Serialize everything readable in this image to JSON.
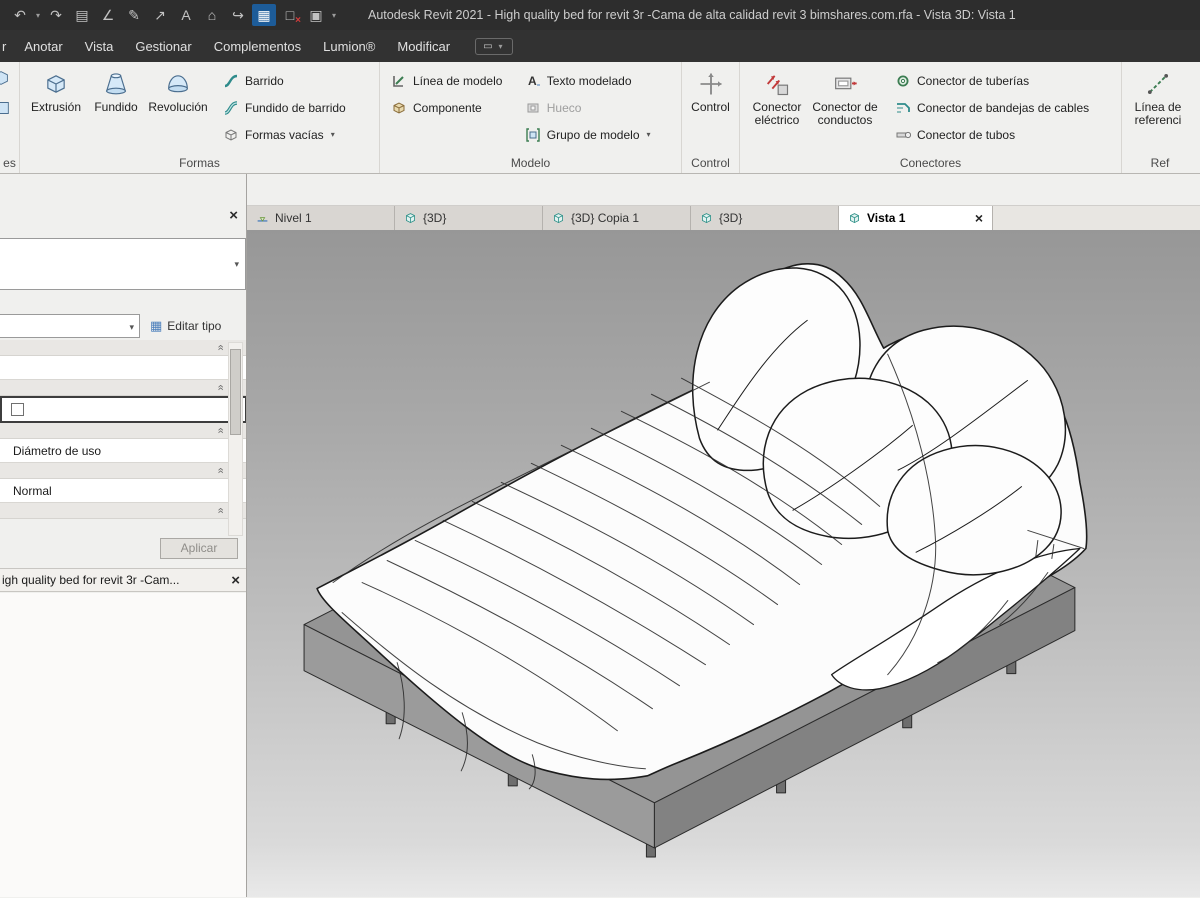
{
  "titlebar": {
    "title": "Autodesk Revit 2021 - High quality bed for revit  3r -Cama de alta calidad revit 3 bimshares.com.rfa - Vista 3D: Vista 1",
    "icons": [
      {
        "name": "undo-icon",
        "glyph": "↶"
      },
      {
        "name": "redo-icon",
        "glyph": "↷"
      },
      {
        "name": "print-icon",
        "glyph": "▤"
      },
      {
        "name": "scale-icon",
        "glyph": "∠"
      },
      {
        "name": "measure-icon",
        "glyph": "✎"
      },
      {
        "name": "dimension-icon",
        "glyph": "↗"
      },
      {
        "name": "text-icon",
        "glyph": "A"
      },
      {
        "name": "view-cube-icon",
        "glyph": "⌂"
      },
      {
        "name": "forward-icon",
        "glyph": "↪"
      },
      {
        "name": "schedule-icon",
        "glyph": "▦"
      },
      {
        "name": "close-hidden-windows-icon",
        "glyph": "□"
      },
      {
        "name": "switch-windows-icon",
        "glyph": "▣"
      }
    ]
  },
  "menubar": {
    "partial_tab": "r",
    "tabs": [
      "Anotar",
      "Vista",
      "Gestionar",
      "Complementos",
      "Lumion®",
      "Modificar"
    ]
  },
  "ribbon": {
    "cut_panel_label": "es",
    "formas": {
      "label": "Formas",
      "buttons": [
        {
          "label": "Extrusión"
        },
        {
          "label": "Fundido"
        },
        {
          "label": "Revolución"
        }
      ],
      "list": [
        {
          "label": "Barrido"
        },
        {
          "label": "Fundido de barrido"
        },
        {
          "label": "Formas vacías",
          "dropdown": true
        }
      ]
    },
    "modelo": {
      "label": "Modelo",
      "col1": [
        {
          "label": "Línea de modelo"
        },
        {
          "label": "Componente"
        }
      ],
      "col2": [
        {
          "label": "Texto modelado"
        },
        {
          "label": "Hueco",
          "disabled": true
        },
        {
          "label": "Grupo de modelo",
          "dropdown": true
        }
      ]
    },
    "control": {
      "label": "Control",
      "button": "Control"
    },
    "conectores": {
      "label": "Conectores",
      "big": [
        {
          "label": "Conector eléctrico"
        },
        {
          "label": "Conector de conductos"
        }
      ],
      "list": [
        {
          "label": "Conector de tuberías"
        },
        {
          "label": "Conector de bandejas de cables"
        },
        {
          "label": "Conector de tubos"
        }
      ]
    },
    "referencia": {
      "label": "Ref",
      "button": "Línea de referenci"
    }
  },
  "properties": {
    "edit_type_label": "Editar tipo",
    "rows": [
      {
        "label": "Diámetro de uso"
      },
      {
        "label": "Normal"
      }
    ],
    "apply_label": "Aplicar",
    "browser_caption": "igh quality bed for revit  3r -Cam..."
  },
  "view_tabs": [
    {
      "label": "Nivel 1",
      "icon": "level-icon",
      "active": false
    },
    {
      "label": "{3D}",
      "icon": "3d-view-icon",
      "active": false
    },
    {
      "label": "{3D} Copia 1",
      "icon": "3d-view-icon",
      "active": false
    },
    {
      "label": "{3D}",
      "icon": "3d-view-icon",
      "active": false
    },
    {
      "label": "Vista 1",
      "icon": "3d-view-icon",
      "active": true,
      "closable": true
    }
  ],
  "ui": {
    "caret_glyph": "▾",
    "close_glyph": "×",
    "collapse_glyph": "«",
    "pill_glyph": "▭",
    "text_icon_glyph": "A"
  }
}
